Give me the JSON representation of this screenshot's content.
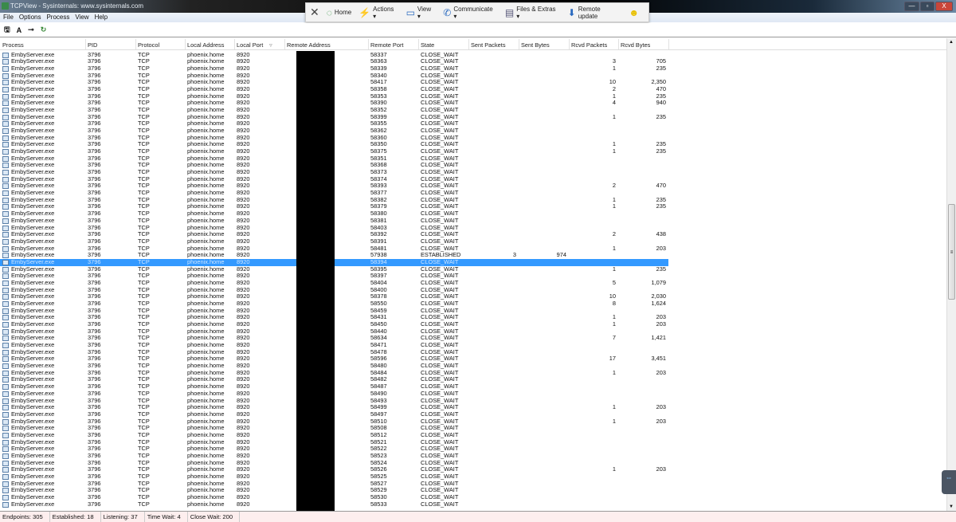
{
  "window": {
    "title": "TCPView - Sysinternals: www.sysinternals.com",
    "minimize": "—",
    "maximize": "▫",
    "close": "X"
  },
  "remote_toolbar": {
    "close": "✕",
    "items": [
      {
        "icon": "home-icon",
        "glyph": "◌",
        "label": "Home"
      },
      {
        "icon": "lightning-icon",
        "glyph": "⚡",
        "label": "Actions ▾"
      },
      {
        "icon": "monitor-icon",
        "glyph": "▭",
        "label": "View ▾"
      },
      {
        "icon": "phone-icon",
        "glyph": "✆",
        "label": "Communicate ▾"
      },
      {
        "icon": "files-icon",
        "glyph": "▤",
        "label": "Files & Extras ▾"
      },
      {
        "icon": "download-icon",
        "glyph": "⬇",
        "label": "Remote update"
      },
      {
        "icon": "smiley-icon",
        "glyph": "☻",
        "label": ""
      }
    ],
    "mini": "▦ ⁞ ^"
  },
  "menu": [
    "File",
    "Options",
    "Process",
    "View",
    "Help"
  ],
  "toolbar": {
    "save": "🖫",
    "font": "A",
    "connect": "⊸",
    "refresh": "↻"
  },
  "columns": [
    "Process",
    "PID",
    "Protocol",
    "Local Address",
    "Local Port",
    "Remote Address",
    "Remote Port",
    "State",
    "Sent Packets",
    "Sent Bytes",
    "Rcvd Packets",
    "Rcvd Bytes"
  ],
  "sort_indicator": "▿",
  "selected_row": 30,
  "common": {
    "process": "EmbyServer.exe",
    "pid": "3796",
    "protocol": "TCP",
    "local_address": "phoenix.home",
    "local_port": "8920"
  },
  "rows": [
    [
      "58337",
      "CLOSE_WAIT",
      "",
      "",
      "",
      ""
    ],
    [
      "58363",
      "CLOSE_WAIT",
      "",
      "",
      "3",
      "705"
    ],
    [
      "58339",
      "CLOSE_WAIT",
      "",
      "",
      "1",
      "235"
    ],
    [
      "58340",
      "CLOSE_WAIT",
      "",
      "",
      "",
      ""
    ],
    [
      "58417",
      "CLOSE_WAIT",
      "",
      "",
      "10",
      "2,350"
    ],
    [
      "58358",
      "CLOSE_WAIT",
      "",
      "",
      "2",
      "470"
    ],
    [
      "58353",
      "CLOSE_WAIT",
      "",
      "",
      "1",
      "235"
    ],
    [
      "58390",
      "CLOSE_WAIT",
      "",
      "",
      "4",
      "940"
    ],
    [
      "58352",
      "CLOSE_WAIT",
      "",
      "",
      "",
      ""
    ],
    [
      "58399",
      "CLOSE_WAIT",
      "",
      "",
      "1",
      "235"
    ],
    [
      "58355",
      "CLOSE_WAIT",
      "",
      "",
      "",
      ""
    ],
    [
      "58362",
      "CLOSE_WAIT",
      "",
      "",
      "",
      ""
    ],
    [
      "58360",
      "CLOSE_WAIT",
      "",
      "",
      "",
      ""
    ],
    [
      "58350",
      "CLOSE_WAIT",
      "",
      "",
      "1",
      "235"
    ],
    [
      "58375",
      "CLOSE_WAIT",
      "",
      "",
      "1",
      "235"
    ],
    [
      "58351",
      "CLOSE_WAIT",
      "",
      "",
      "",
      ""
    ],
    [
      "58368",
      "CLOSE_WAIT",
      "",
      "",
      "",
      ""
    ],
    [
      "58373",
      "CLOSE_WAIT",
      "",
      "",
      "",
      ""
    ],
    [
      "58374",
      "CLOSE_WAIT",
      "",
      "",
      "",
      ""
    ],
    [
      "58393",
      "CLOSE_WAIT",
      "",
      "",
      "2",
      "470"
    ],
    [
      "58377",
      "CLOSE_WAIT",
      "",
      "",
      "",
      ""
    ],
    [
      "58382",
      "CLOSE_WAIT",
      "",
      "",
      "1",
      "235"
    ],
    [
      "58379",
      "CLOSE_WAIT",
      "",
      "",
      "1",
      "235"
    ],
    [
      "58380",
      "CLOSE_WAIT",
      "",
      "",
      "",
      ""
    ],
    [
      "58381",
      "CLOSE_WAIT",
      "",
      "",
      "",
      ""
    ],
    [
      "58403",
      "CLOSE_WAIT",
      "",
      "",
      "",
      ""
    ],
    [
      "58392",
      "CLOSE_WAIT",
      "",
      "",
      "2",
      "438"
    ],
    [
      "58391",
      "CLOSE_WAIT",
      "",
      "",
      "",
      ""
    ],
    [
      "58481",
      "CLOSE_WAIT",
      "",
      "",
      "1",
      "203"
    ],
    [
      "57938",
      "ESTABLISHED",
      "3",
      "974",
      "",
      ""
    ],
    [
      "58394",
      "CLOSE_WAIT",
      "",
      "",
      "",
      ""
    ],
    [
      "58395",
      "CLOSE_WAIT",
      "",
      "",
      "1",
      "235"
    ],
    [
      "58397",
      "CLOSE_WAIT",
      "",
      "",
      "",
      ""
    ],
    [
      "58404",
      "CLOSE_WAIT",
      "",
      "",
      "5",
      "1,079"
    ],
    [
      "58400",
      "CLOSE_WAIT",
      "",
      "",
      "",
      ""
    ],
    [
      "58378",
      "CLOSE_WAIT",
      "",
      "",
      "10",
      "2,030"
    ],
    [
      "58550",
      "CLOSE_WAIT",
      "",
      "",
      "8",
      "1,624"
    ],
    [
      "58459",
      "CLOSE_WAIT",
      "",
      "",
      "",
      ""
    ],
    [
      "58431",
      "CLOSE_WAIT",
      "",
      "",
      "1",
      "203"
    ],
    [
      "58450",
      "CLOSE_WAIT",
      "",
      "",
      "1",
      "203"
    ],
    [
      "58440",
      "CLOSE_WAIT",
      "",
      "",
      "",
      ""
    ],
    [
      "58634",
      "CLOSE_WAIT",
      "",
      "",
      "7",
      "1,421"
    ],
    [
      "58471",
      "CLOSE_WAIT",
      "",
      "",
      "",
      ""
    ],
    [
      "58478",
      "CLOSE_WAIT",
      "",
      "",
      "",
      ""
    ],
    [
      "58596",
      "CLOSE_WAIT",
      "",
      "",
      "17",
      "3,451"
    ],
    [
      "58480",
      "CLOSE_WAIT",
      "",
      "",
      "",
      ""
    ],
    [
      "58484",
      "CLOSE_WAIT",
      "",
      "",
      "1",
      "203"
    ],
    [
      "58482",
      "CLOSE_WAIT",
      "",
      "",
      "",
      ""
    ],
    [
      "58487",
      "CLOSE_WAIT",
      "",
      "",
      "",
      ""
    ],
    [
      "58490",
      "CLOSE_WAIT",
      "",
      "",
      "",
      ""
    ],
    [
      "58493",
      "CLOSE_WAIT",
      "",
      "",
      "",
      ""
    ],
    [
      "58499",
      "CLOSE_WAIT",
      "",
      "",
      "1",
      "203"
    ],
    [
      "58497",
      "CLOSE_WAIT",
      "",
      "",
      "",
      ""
    ],
    [
      "58510",
      "CLOSE_WAIT",
      "",
      "",
      "1",
      "203"
    ],
    [
      "58508",
      "CLOSE_WAIT",
      "",
      "",
      "",
      ""
    ],
    [
      "58512",
      "CLOSE_WAIT",
      "",
      "",
      "",
      ""
    ],
    [
      "58521",
      "CLOSE_WAIT",
      "",
      "",
      "",
      ""
    ],
    [
      "58522",
      "CLOSE_WAIT",
      "",
      "",
      "",
      ""
    ],
    [
      "58523",
      "CLOSE_WAIT",
      "",
      "",
      "",
      ""
    ],
    [
      "58524",
      "CLOSE_WAIT",
      "",
      "",
      "",
      ""
    ],
    [
      "58526",
      "CLOSE_WAIT",
      "",
      "",
      "1",
      "203"
    ],
    [
      "58525",
      "CLOSE_WAIT",
      "",
      "",
      "",
      ""
    ],
    [
      "58527",
      "CLOSE_WAIT",
      "",
      "",
      "",
      ""
    ],
    [
      "58529",
      "CLOSE_WAIT",
      "",
      "",
      "",
      ""
    ],
    [
      "58530",
      "CLOSE_WAIT",
      "",
      "",
      "",
      ""
    ],
    [
      "58533",
      "CLOSE_WAIT",
      "",
      "",
      "",
      ""
    ]
  ],
  "status": {
    "endpoints": "Endpoints: 305",
    "established": "Established: 18",
    "listening": "Listening: 37",
    "time_wait": "Time Wait: 4",
    "close_wait": "Close Wait: 200"
  },
  "scroll": {
    "grip": "≡"
  },
  "colors": {
    "selection": "#3399ff",
    "status_bg": "#fdeeee"
  }
}
